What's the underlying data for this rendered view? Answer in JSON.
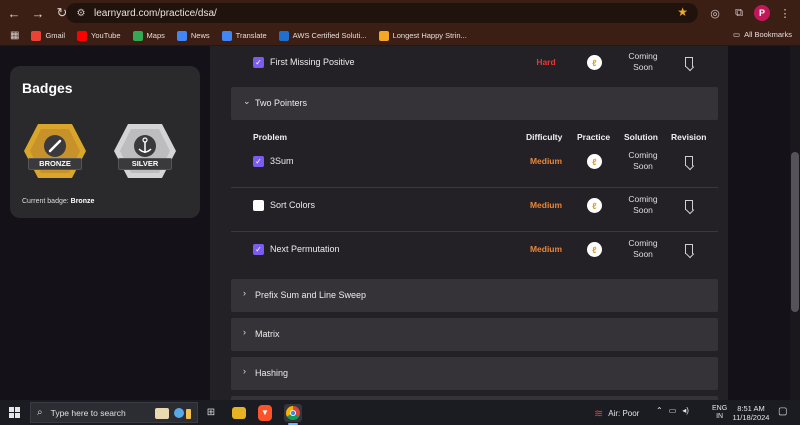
{
  "browser": {
    "url": "learnyard.com/practice/dsa/",
    "profile_initial": "P",
    "bookmarks": [
      {
        "label": "Gmail",
        "color": "#ea4335"
      },
      {
        "label": "YouTube",
        "color": "#ff0000"
      },
      {
        "label": "Maps",
        "color": "#34a853"
      },
      {
        "label": "News",
        "color": "#4285f4"
      },
      {
        "label": "Translate",
        "color": "#4285f4"
      },
      {
        "label": "AWS Certified Soluti...",
        "color": "#1f6fd1"
      },
      {
        "label": "Longest Happy Strin...",
        "color": "#f5a623"
      }
    ],
    "all_bookmarks": "All Bookmarks"
  },
  "sidebar": {
    "badges_title": "Badges",
    "badges": [
      {
        "label": "BRONZE",
        "color": "#d9a62b"
      },
      {
        "label": "SILVER",
        "color": "#cfcfd2"
      }
    ],
    "current_badge_label": "Current badge:",
    "current_badge_value": "Bronze"
  },
  "table_headers": {
    "problem": "Problem",
    "difficulty": "Difficulty",
    "practice": "Practice",
    "solution": "Solution",
    "revision": "Revision"
  },
  "top_row": {
    "name": "First Missing Positive",
    "difficulty": "Hard",
    "solution_line1": "Coming",
    "solution_line2": "Soon",
    "checked": true
  },
  "sections": {
    "two_pointers": "Two Pointers",
    "prefix_sum": "Prefix Sum and Line Sweep",
    "matrix": "Matrix",
    "hashing": "Hashing"
  },
  "two_pointer_rows": [
    {
      "name": "3Sum",
      "difficulty": "Medium",
      "solution_line1": "Coming",
      "solution_line2": "Soon",
      "checked": true
    },
    {
      "name": "Sort Colors",
      "difficulty": "Medium",
      "solution_line1": "Coming",
      "solution_line2": "Soon",
      "checked": false
    },
    {
      "name": "Next Permutation",
      "difficulty": "Medium",
      "solution_line1": "Coming",
      "solution_line2": "Soon",
      "checked": true
    }
  ],
  "taskbar": {
    "search_placeholder": "Type here to search",
    "weather": "Air: Poor",
    "lang_line1": "ENG",
    "lang_line2": "IN",
    "time": "8:51 AM",
    "date": "11/18/2024"
  },
  "colors": {
    "hard": "#e53935",
    "medium": "#e8863a",
    "checkbox": "#7c5cf0",
    "panel": "#232125",
    "section": "#353337"
  }
}
